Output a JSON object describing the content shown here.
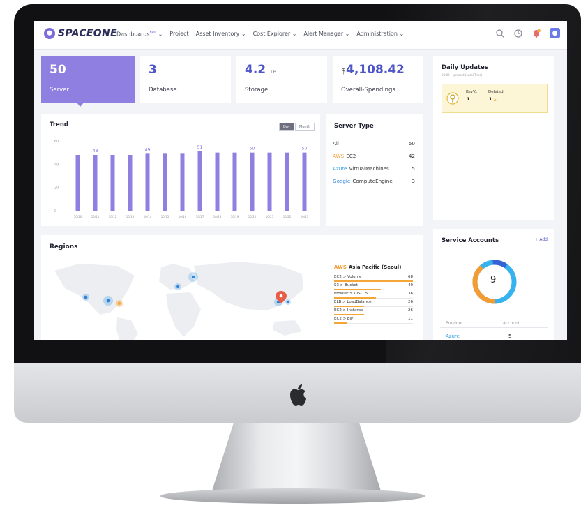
{
  "nav": {
    "logo": "SPACEONE",
    "new_badge": "NEW",
    "items": [
      "Dashboards",
      "Project",
      "Asset Inventory ⌄",
      "Cost Explorer ⌄",
      "Alert Manager ⌄",
      "Administration ⌄"
    ]
  },
  "icons": {
    "search": "search-icon",
    "recent": "recent-icon",
    "notification": "notification-icon",
    "user": "user-menu-icon"
  },
  "summary": {
    "server": {
      "value": "50",
      "label": "Server"
    },
    "database": {
      "value": "3",
      "label": "Database"
    },
    "storage": {
      "value": "4.2",
      "unit": "TB",
      "label": "Storage"
    },
    "spending": {
      "currency": "$",
      "value": "4,108.42",
      "label": "Overall-Spendings"
    }
  },
  "trend": {
    "title": "Trend",
    "toggle_day": "Day",
    "toggle_month": "Month"
  },
  "chart_data": {
    "type": "bar",
    "title": "Trend",
    "categories": [
      "10/10",
      "10/11",
      "10/12",
      "10/13",
      "10/14",
      "10/15",
      "10/16",
      "10/17",
      "10/18",
      "10/19",
      "10/20",
      "10/21",
      "10/22",
      "10/23"
    ],
    "values": [
      48,
      48,
      48,
      48,
      49,
      49,
      49,
      51,
      50,
      50,
      50,
      50,
      50,
      50
    ],
    "data_labels": {
      "1": "48",
      "4": "49",
      "7": "51",
      "10": "50",
      "13": "50"
    },
    "ylim": [
      0,
      60
    ],
    "yticks": [
      "60",
      "40",
      "20",
      "0"
    ],
    "color": "#8e7fe1",
    "grid": false
  },
  "server_type": {
    "title": "Server Type",
    "rows": [
      {
        "provider": "",
        "name": "All",
        "count": "50"
      },
      {
        "provider": "AWS",
        "name": "EC2",
        "count": "42"
      },
      {
        "provider": "Azure",
        "name": "VirtualMachines",
        "count": "5"
      },
      {
        "provider": "Google",
        "name": "ComputeEngine",
        "count": "3"
      }
    ],
    "provider_colors": {
      "AWS": "#f39c33",
      "Azure": "#2d9fe6",
      "Google": "#3a87e0"
    }
  },
  "regions": {
    "title": "Regions",
    "selected_provider": "AWS",
    "selected_region": "Asia Pacific (Seoul)",
    "rows": [
      {
        "name": "EC2 > Volume",
        "count": "68",
        "fill": 1.0
      },
      {
        "name": "S3 > Bucket",
        "count": "40",
        "fill": 0.59
      },
      {
        "name": "Prowler > CIS-1.5",
        "count": "36",
        "fill": 0.53
      },
      {
        "name": "ELB > LoadBalancer",
        "count": "26",
        "fill": 0.38
      },
      {
        "name": "EC2 > Instance",
        "count": "26",
        "fill": 0.38
      },
      {
        "name": "EC2 > EIP",
        "count": "11",
        "fill": 0.16
      }
    ]
  },
  "daily_updates": {
    "title": "Daily Updates",
    "subtitle": "00:00 ~ present (Local Time)",
    "item_name": "KeyV...",
    "item_count": "1",
    "deleted_label": "Deleted",
    "deleted_count": "1"
  },
  "service_accounts": {
    "title": "Service Accounts",
    "add_label": "+ Add",
    "total": "9",
    "col_provider": "Provider",
    "col_account": "Account",
    "rows": [
      {
        "provider": "Azure",
        "account": "5"
      }
    ]
  }
}
